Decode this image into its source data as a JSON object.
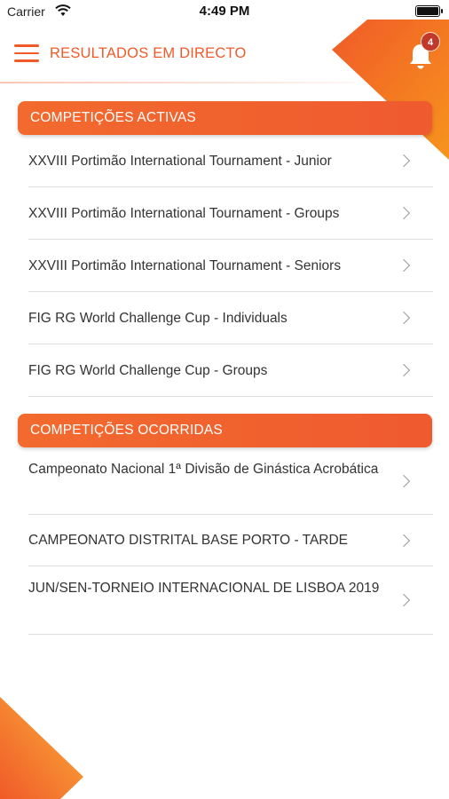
{
  "status_bar": {
    "carrier": "Carrier",
    "time": "4:49 PM"
  },
  "header": {
    "title": "RESULTADOS EM DIRECTO",
    "notification_count": "4"
  },
  "sections": {
    "active": {
      "title": "COMPETIÇÕES ACTIVAS",
      "items": [
        "XXVIII Portimão International Tournament - Junior",
        "XXVIII Portimão International Tournament - Groups",
        "XXVIII Portimão International Tournament - Seniors",
        "FIG RG World Challenge Cup - Individuals",
        "FIG RG World Challenge Cup - Groups"
      ]
    },
    "past": {
      "title": "COMPETIÇÕES OCORRIDAS",
      "items": [
        "Campeonato Nacional 1ª Divisão de Ginástica Acrobática",
        "CAMPEONATO DISTRITAL BASE PORTO - TARDE",
        "JUN/SEN-TORNEIO INTERNACIONAL DE LISBOA 2019"
      ]
    }
  },
  "colors": {
    "accent": "#f05a28",
    "accent_light": "#f7941d",
    "badge": "#c0392b"
  },
  "icons": {
    "menu": "hamburger-menu-icon",
    "bell": "bell-icon",
    "chevron": "chevron-right-icon",
    "wifi": "wifi-icon",
    "battery": "battery-icon"
  }
}
